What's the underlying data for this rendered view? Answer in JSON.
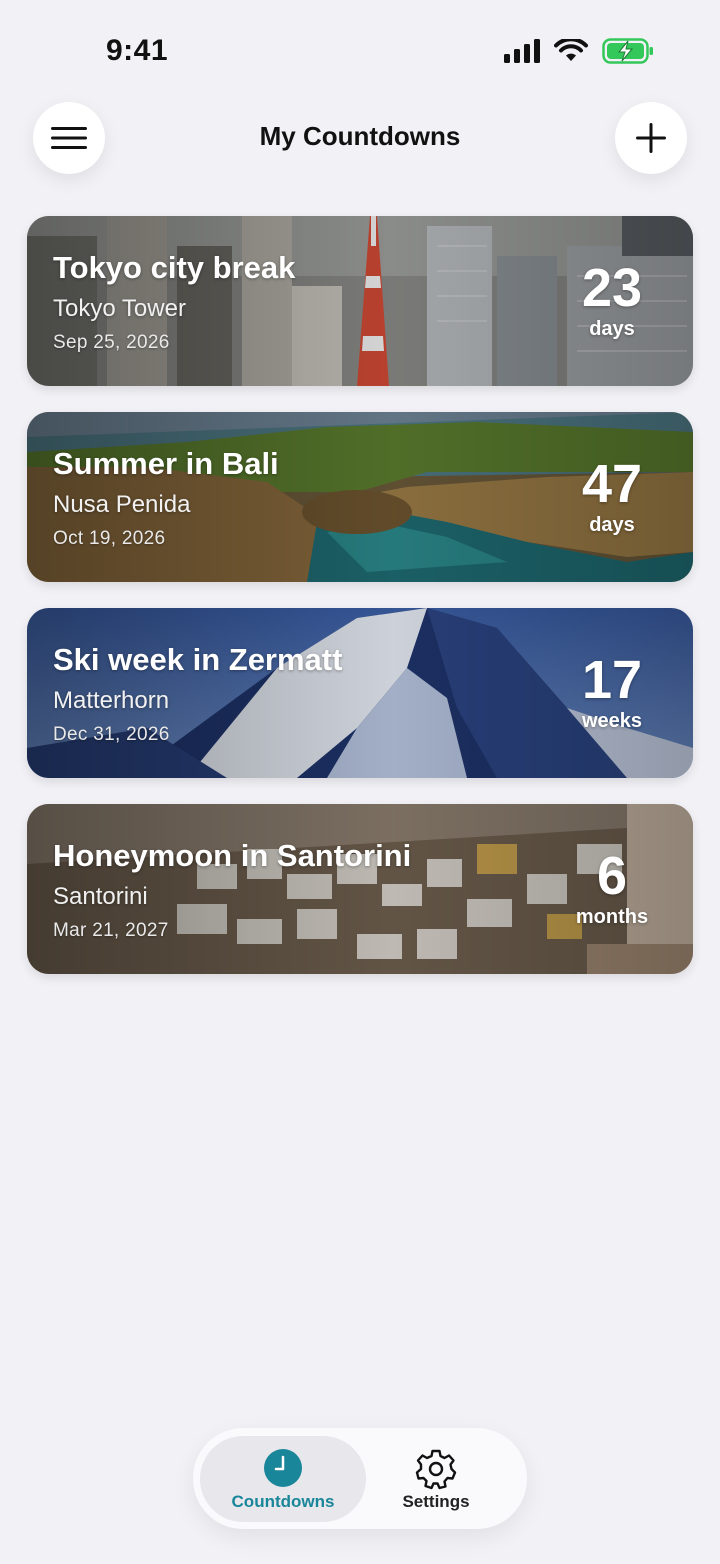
{
  "status_bar": {
    "time": "9:41"
  },
  "header": {
    "title": "My Countdowns"
  },
  "countdowns": [
    {
      "name": "Tokyo city break",
      "place": "Tokyo Tower",
      "date": "Sep 25, 2026",
      "value": "23",
      "unit": "days"
    },
    {
      "name": "Summer in Bali",
      "place": "Nusa Penida",
      "date": "Oct 19, 2026",
      "value": "47",
      "unit": "days"
    },
    {
      "name": "Ski week in Zermatt",
      "place": "Matterhorn",
      "date": "Dec 31, 2026",
      "value": "17",
      "unit": "weeks"
    },
    {
      "name": "Honeymoon in Santorini",
      "place": "Santorini",
      "date": "Mar 21, 2027",
      "value": "6",
      "unit": "months"
    }
  ],
  "tab_bar": {
    "tabs": [
      {
        "label": "Countdowns",
        "icon": "clock-icon",
        "selected": true
      },
      {
        "label": "Settings",
        "icon": "gear-icon",
        "selected": false
      }
    ]
  },
  "colors": {
    "accent": "#1a8699",
    "background": "#f1f1f6",
    "battery": "#34c759"
  }
}
